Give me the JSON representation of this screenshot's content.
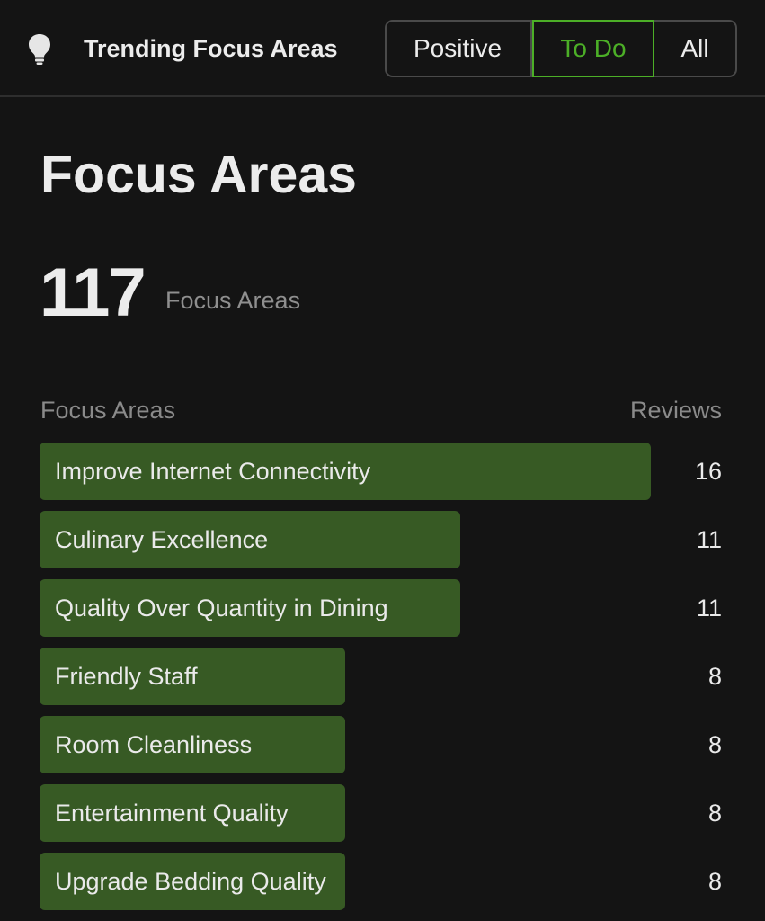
{
  "header": {
    "icon": "lightbulb-icon",
    "title": "Trending Focus Areas",
    "filters": [
      {
        "label": "Positive",
        "selected": false
      },
      {
        "label": "To Do",
        "selected": true
      },
      {
        "label": "All",
        "selected": false
      }
    ]
  },
  "colors": {
    "accent": "#4caf27",
    "bar": "#375a24",
    "background": "#141414"
  },
  "page_title": "Focus Areas",
  "summary": {
    "count": "117",
    "label": "Focus Areas"
  },
  "table": {
    "headers": {
      "left": "Focus Areas",
      "right": "Reviews"
    },
    "max_value": 16,
    "rows": [
      {
        "label": "Improve Internet Connectivity",
        "value": "16"
      },
      {
        "label": "Culinary Excellence",
        "value": "11"
      },
      {
        "label": "Quality Over Quantity in Dining",
        "value": "11"
      },
      {
        "label": "Friendly Staff",
        "value": "8"
      },
      {
        "label": "Room Cleanliness",
        "value": "8"
      },
      {
        "label": "Entertainment Quality",
        "value": "8"
      },
      {
        "label": "Upgrade Bedding Quality",
        "value": "8"
      }
    ]
  }
}
